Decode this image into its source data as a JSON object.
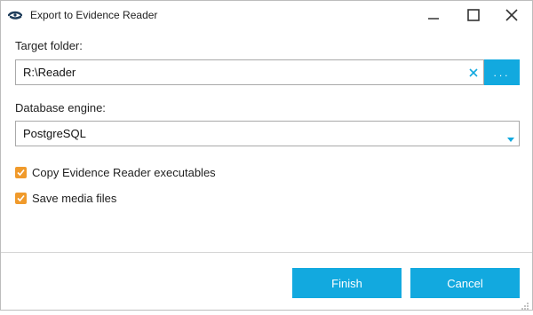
{
  "window": {
    "title": "Export to Evidence Reader",
    "icon": "evidence-reader-app-icon"
  },
  "target_folder": {
    "label": "Target folder:",
    "value": "R:\\Reader",
    "browse_label": "...",
    "clear_icon": "clear-x-icon"
  },
  "database_engine": {
    "label": "Database engine:",
    "selected": "PostgreSQL",
    "arrow_icon": "dropdown-arrow-icon"
  },
  "options": [
    {
      "label": "Copy Evidence Reader executables",
      "checked": true
    },
    {
      "label": "Save media files",
      "checked": true
    }
  ],
  "buttons": {
    "finish": "Finish",
    "cancel": "Cancel"
  },
  "colors": {
    "accent": "#12a9df",
    "checkbox": "#f09a2b"
  }
}
